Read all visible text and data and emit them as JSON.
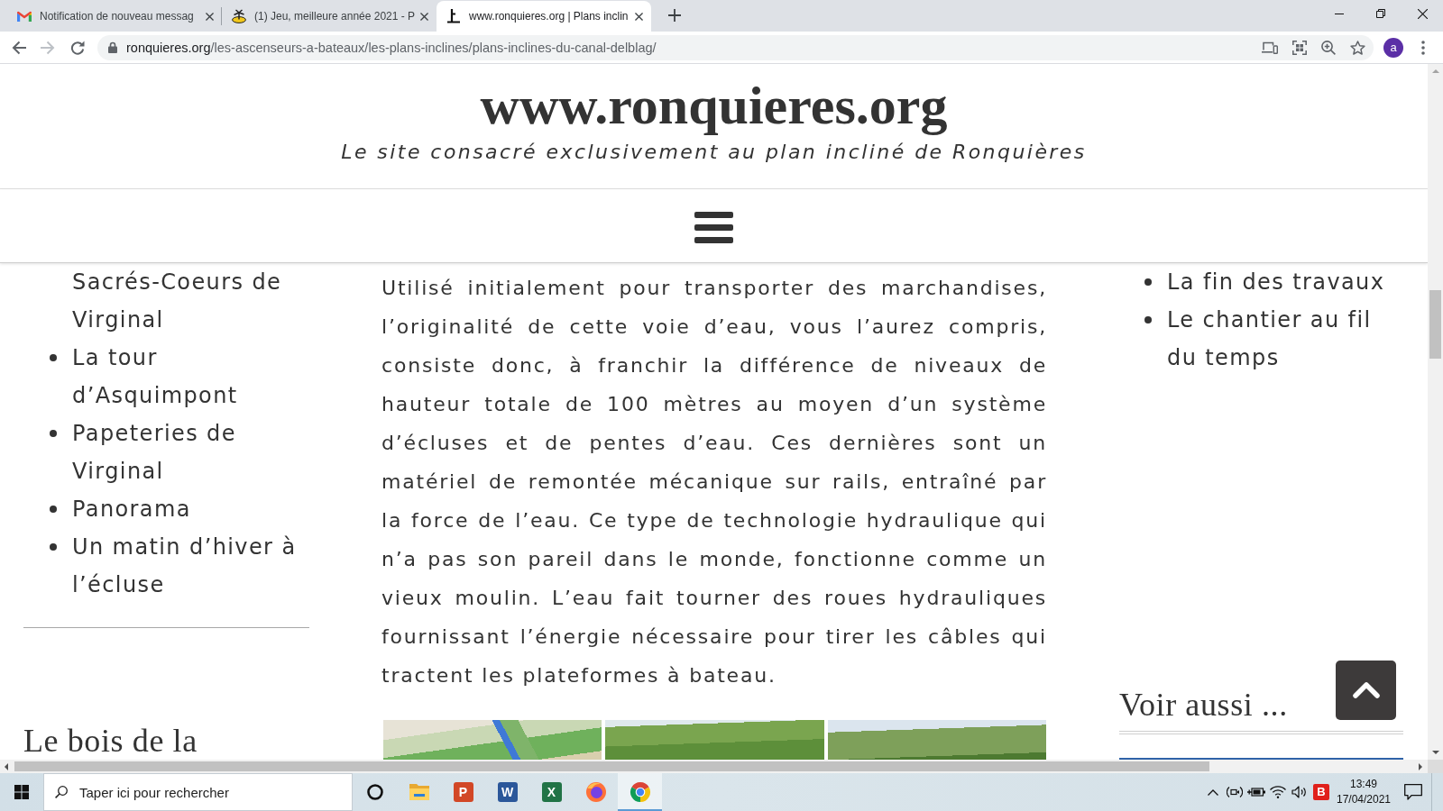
{
  "browser": {
    "tabs": [
      {
        "kind": "mail",
        "title": "Notification de nouveau messag",
        "selected": false
      },
      {
        "kind": "island",
        "title": "(1) Jeu, meilleure année 2021 - P",
        "selected": false
      },
      {
        "kind": "site",
        "title": "www.ronquieres.org | Plans inclin",
        "selected": true
      }
    ],
    "toolbar": {
      "forward_disabled": true,
      "url": {
        "host": "ronquieres.org",
        "path": "/les-ascenseurs-a-bateaux/les-plans-inclines/plans-inclines-du-canal-delblag/"
      },
      "avatar": "a"
    }
  },
  "site": {
    "title": "www.ronquieres.org",
    "tagline": "Le site consacré exclusivement au plan incliné de Ronquières",
    "left_sidebar": {
      "items": [
        {
          "kind": "continuation",
          "text": "Sacrés-Coeurs de Virginal"
        },
        {
          "kind": "bullet",
          "text": "La tour d’Asquimpont"
        },
        {
          "kind": "bullet",
          "text": "Papeteries de Virginal"
        },
        {
          "kind": "bullet",
          "text": "Panorama"
        },
        {
          "kind": "bullet",
          "text": "Un matin d’hiver à l’écluse"
        }
      ],
      "heading": "Le bois de la"
    },
    "article": {
      "paragraph": "Utilisé initialement pour transporter des marchandises, l’originalité de cette voie d’eau, vous l’aurez compris, consiste donc, à franchir la différence de niveaux de hauteur totale de 100 mètres au moyen d’un système d’écluses et de pentes d’eau. Ces dernières sont un matériel de remontée mécanique sur rails, entraîné par la force de l’eau. Ce type de technologie hydraulique qui n’a pas son pareil dans le monde, fonctionne comme un vieux moulin. L’eau fait tourner des roues hydrauliques fournissant l’énergie nécessaire pour tirer les câbles qui tractent les plateformes à bateau.",
      "photos": [
        {
          "kind": "aerial"
        },
        {
          "kind": "forest"
        },
        {
          "kind": "forest_sky"
        }
      ]
    },
    "right_sidebar": {
      "items": [
        {
          "kind": "bullet",
          "text": "La fin des travaux"
        },
        {
          "kind": "bullet",
          "text": "Le chantier au fil du temps"
        }
      ],
      "heading": "Voir aussi ...",
      "photos": [
        {
          "kind": "banner"
        }
      ]
    }
  },
  "taskbar": {
    "search": {
      "placeholder": "Taper ici pour rechercher"
    },
    "apps": [
      {
        "kind": "explorer",
        "selected": false
      },
      {
        "kind": "powerpoint",
        "letter": "P",
        "selected": false
      },
      {
        "kind": "word",
        "letter": "W",
        "selected": false
      },
      {
        "kind": "excel",
        "letter": "X",
        "selected": false
      },
      {
        "kind": "firefox",
        "selected": false
      },
      {
        "kind": "chrome",
        "selected": true
      }
    ],
    "tray": {
      "badge": "B",
      "time": "13:49",
      "date": "17/04/2021"
    }
  }
}
